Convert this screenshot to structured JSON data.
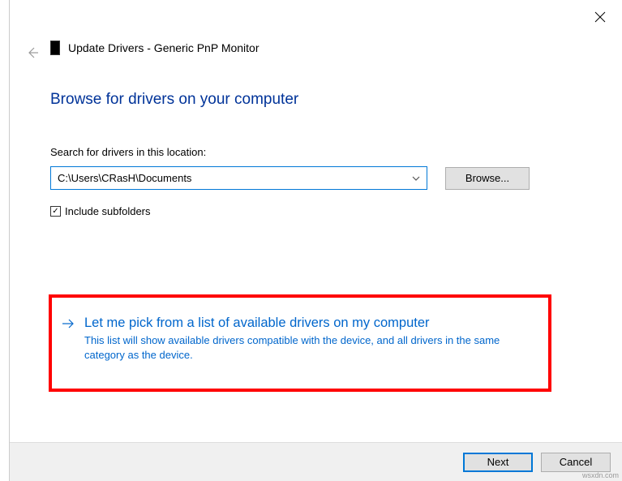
{
  "window": {
    "title": "Update Drivers - Generic PnP Monitor"
  },
  "heading": "Browse for drivers on your computer",
  "search": {
    "label": "Search for drivers in this location:",
    "path_value": "C:\\Users\\CRasH\\Documents",
    "browse_label": "Browse...",
    "include_subfolders_label": "Include subfolders",
    "include_subfolders_checked": true
  },
  "pick_option": {
    "title": "Let me pick from a list of available drivers on my computer",
    "description": "This list will show available drivers compatible with the device, and all drivers in the same category as the device."
  },
  "footer": {
    "next_label": "Next",
    "cancel_label": "Cancel"
  },
  "watermark": "wsxdn.com"
}
